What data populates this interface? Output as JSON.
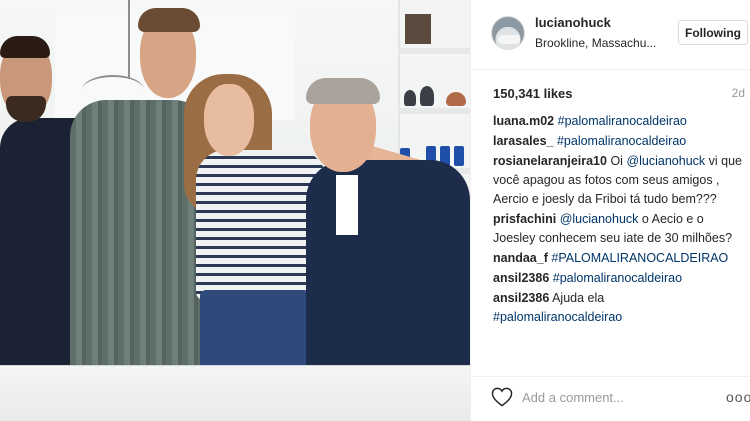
{
  "post": {
    "username": "lucianohuck",
    "location": "Brookline, Massachu...",
    "follow_label": "Following",
    "likes": "150,341 likes",
    "age": "2d"
  },
  "comments": [
    {
      "user": "luana.m02",
      "text": "",
      "tag": "#palomaliranocaldeirao"
    },
    {
      "user": "larasales_",
      "text": "",
      "tag": "#palomaliranocaldeirao"
    },
    {
      "user": "rosianelaranjeira10",
      "text": "Oi ",
      "mention": "@lucianohuck",
      "text2": " vi que você apagou as fotos com seus amigos , Aercio e joesly da Friboi tá tudo bem???"
    },
    {
      "user": "prisfachini",
      "text": "",
      "mention": "@lucianohuck",
      "text2": " o Aecio e o Joesley conhecem seu iate de 30 milhões?"
    },
    {
      "user": "nandaa_f",
      "text": "",
      "tag": "#PALOMALIRANOCALDEIRAO"
    },
    {
      "user": "ansil2386",
      "text": "",
      "tag": "#palomaliranocaldeirao"
    },
    {
      "user": "ansil2386",
      "text": "Ajuda ela",
      "tag": "#palomaliranocaldeirao"
    }
  ],
  "footer": {
    "add_comment_placeholder": "Add a comment...",
    "more_label": "ooo"
  },
  "colors": {
    "link": "#003569",
    "muted": "#999999",
    "text": "#262626"
  },
  "icons": {
    "like": "heart-outline-icon",
    "options": "more-options-icon"
  }
}
